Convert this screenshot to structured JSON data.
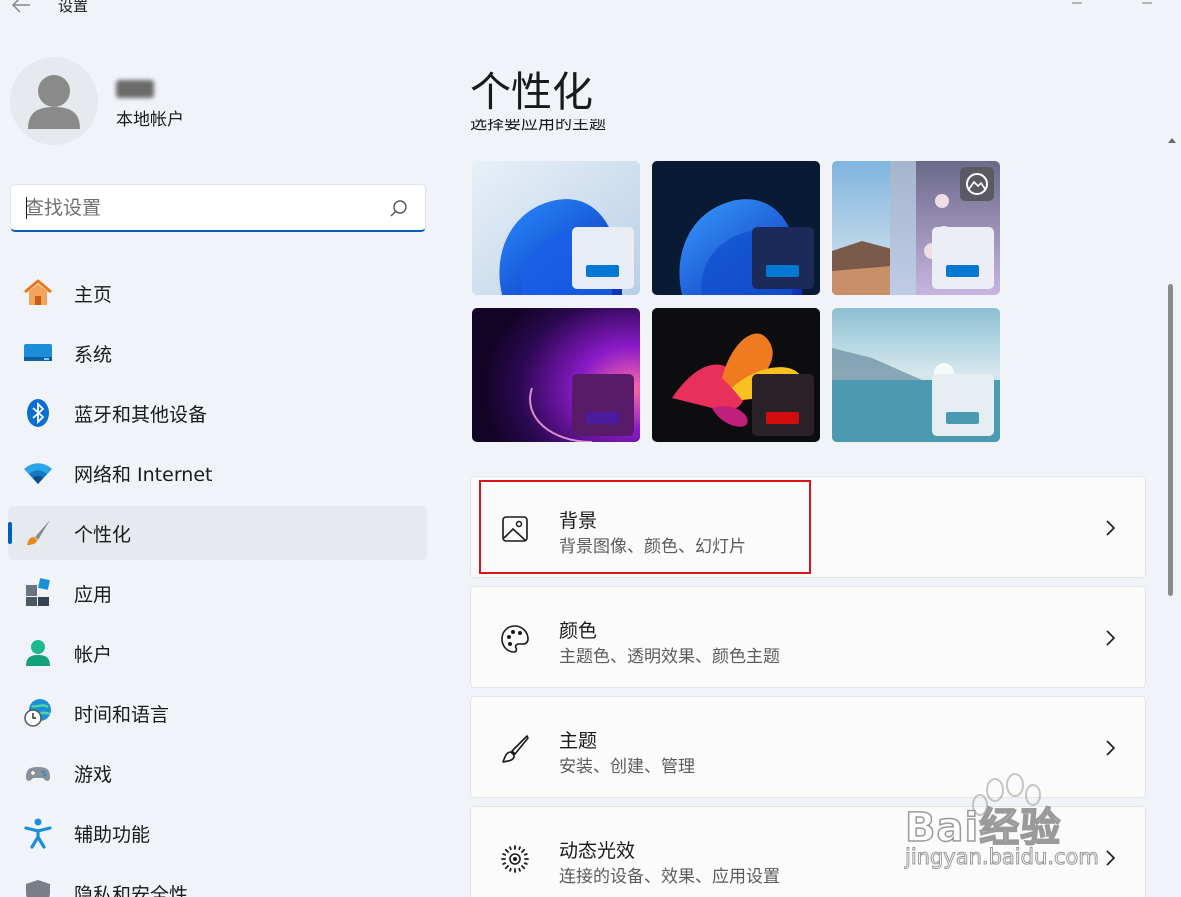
{
  "app": {
    "title": "设置"
  },
  "user": {
    "account_type": "本地帐户"
  },
  "search": {
    "placeholder": "查找设置"
  },
  "sidebar": {
    "items": [
      {
        "label": "主页",
        "icon": "home-icon"
      },
      {
        "label": "系统",
        "icon": "system-icon"
      },
      {
        "label": "蓝牙和其他设备",
        "icon": "bluetooth-icon"
      },
      {
        "label": "网络和 Internet",
        "icon": "wifi-icon"
      },
      {
        "label": "个性化",
        "icon": "brush-icon",
        "active": true
      },
      {
        "label": "应用",
        "icon": "apps-icon"
      },
      {
        "label": "帐户",
        "icon": "account-icon"
      },
      {
        "label": "时间和语言",
        "icon": "time-language-icon"
      },
      {
        "label": "游戏",
        "icon": "gamepad-icon"
      },
      {
        "label": "辅助功能",
        "icon": "accessibility-icon"
      },
      {
        "label": "隐私和安全性",
        "icon": "shield-icon"
      }
    ]
  },
  "main": {
    "title": "个性化",
    "section_label": "选择要应用的主题",
    "themes": [
      {
        "name": "light-bloom",
        "accent": "#0078d4"
      },
      {
        "name": "dark-bloom",
        "accent": "#0078d4"
      },
      {
        "name": "spotlight",
        "accent": "#0078d4"
      },
      {
        "name": "glow",
        "accent": "#4b1c9e"
      },
      {
        "name": "captured-motion",
        "accent": "#d10d0d"
      },
      {
        "name": "flow",
        "accent": "#4a9ab2"
      }
    ],
    "cards": [
      {
        "title": "背景",
        "subtitle": "背景图像、颜色、幻灯片",
        "icon": "image-icon"
      },
      {
        "title": "颜色",
        "subtitle": "主题色、透明效果、颜色主题",
        "icon": "palette-icon"
      },
      {
        "title": "主题",
        "subtitle": "安装、创建、管理",
        "icon": "brush-icon"
      },
      {
        "title": "动态光效",
        "subtitle": "连接的设备、效果、应用设置",
        "icon": "dynamic-lighting-icon"
      }
    ]
  },
  "watermark": {
    "brand": "Bai经验",
    "url": "jingyan.baidu.com"
  },
  "colors": {
    "accent": "#005fb8",
    "highlight": "#d7141b"
  }
}
